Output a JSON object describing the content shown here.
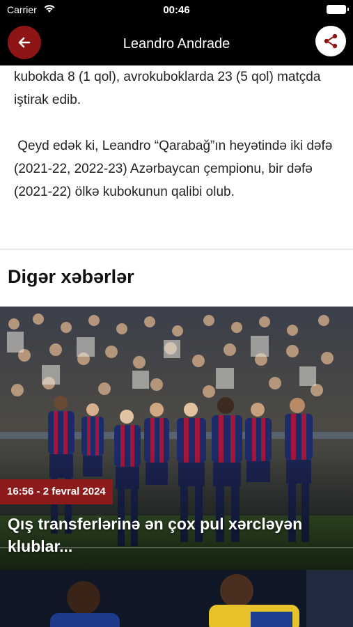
{
  "status_bar": {
    "carrier": "Carrier",
    "time": "00:46"
  },
  "header": {
    "title": "Leandro Andrade",
    "back_icon": "arrow-left-icon",
    "share_icon": "share-icon"
  },
  "article": {
    "paragraph_top": "kubokda 8 (1 qol), avrokuboklarda 23 (5 qol) matçda iştirak edib.",
    "paragraph_2": "Qeyd edək ki, Leandro “Qarabağ”ın heyətində iki dəfə (2021-22, 2022-23) Azərbaycan çempionu, bir dəfə (2021-22) ölkə kubokunun qalibi olub."
  },
  "other_news": {
    "section_title": "Digər xəbərlər",
    "items": [
      {
        "date": "16:56 - 2 fevral 2024",
        "title": "Qış transferlərinə ən çox pul xərcləyən klublar..."
      }
    ]
  },
  "colors": {
    "accent": "#8e1515",
    "header_bg": "#000000",
    "badge_bg": "#8e1b1b"
  }
}
